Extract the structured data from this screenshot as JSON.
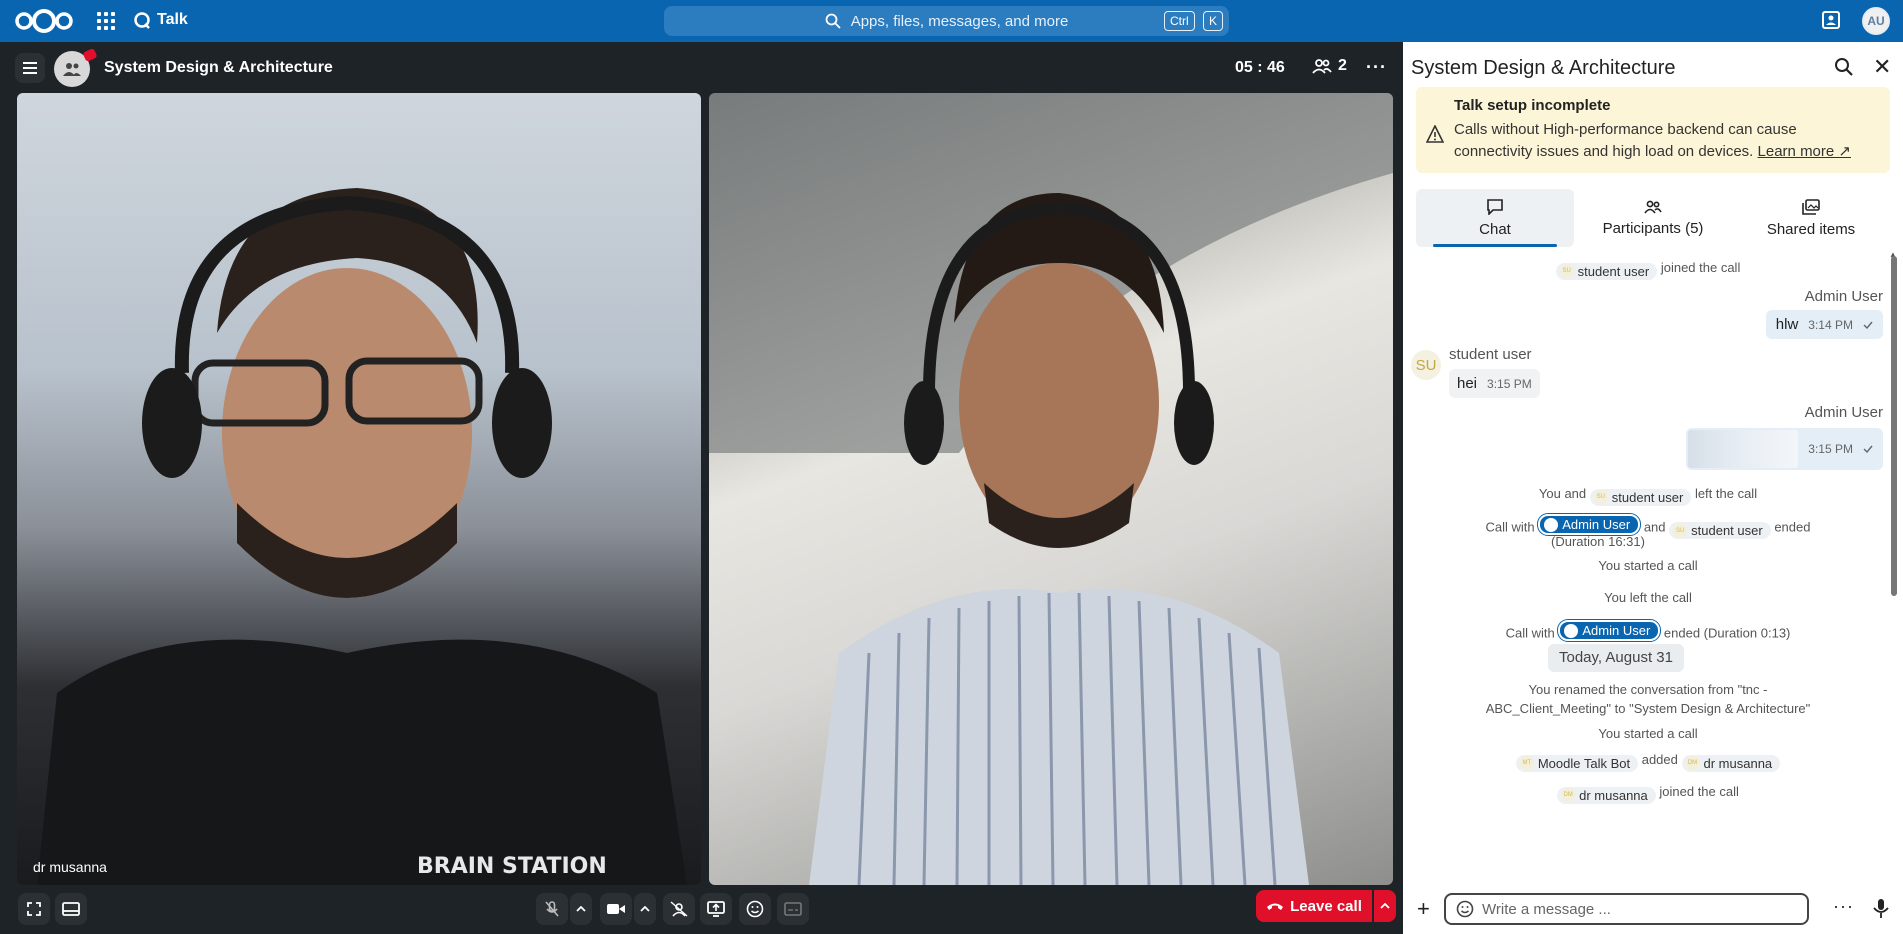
{
  "topbar": {
    "app_name": "Talk",
    "search_placeholder": "Apps, files, messages, and more",
    "kbd_ctrl": "Ctrl",
    "kbd_k": "K",
    "avatar_initials": "AU"
  },
  "call": {
    "title": "System Design & Architecture",
    "timer": "05 : 46",
    "participants_count": "2",
    "tile1_name": "dr musanna",
    "leave_label": "Leave call"
  },
  "sidebar": {
    "title": "System Design & Architecture",
    "warning_title": "Talk setup incomplete",
    "warning_body": "Calls without High-performance backend can cause connectivity issues and high load on devices.",
    "warning_link": "Learn more ↗",
    "tabs": [
      {
        "label": "Chat"
      },
      {
        "label": "Participants (5)"
      },
      {
        "label": "Shared items"
      }
    ]
  },
  "chat": {
    "student_user": "student user",
    "admin_user": "Admin User",
    "joined_the_call": "joined the call",
    "msg1_text": "hlw",
    "msg1_time": "3:14 PM",
    "msg2_sender": "student user",
    "msg2_avatar": "SU",
    "msg2_text": "hei",
    "msg2_time": "3:15 PM",
    "msg3_time": "3:15 PM",
    "you_and": "You and",
    "left_the_call": "left the call",
    "call_with": "Call with",
    "and": "and",
    "ended": "ended",
    "duration1": "(Duration 16:31)",
    "you_started": "You started a call",
    "you_left": "You left the call",
    "ended_duration2": "ended (Duration 0:13)",
    "date_divider": "Today, August 31",
    "renamed_line1": "You renamed the conversation from \"tnc -",
    "renamed_line2": "ABC_Client_Meeting\" to \"System Design & Architecture\"",
    "you_started2": "You started a call",
    "moodle_bot": "Moodle Talk Bot",
    "added": "added",
    "dr_musanna": "dr musanna",
    "chip_su": "SU",
    "chip_mt": "MT",
    "chip_dm": "DM",
    "composer_placeholder": "Write a message ..."
  }
}
